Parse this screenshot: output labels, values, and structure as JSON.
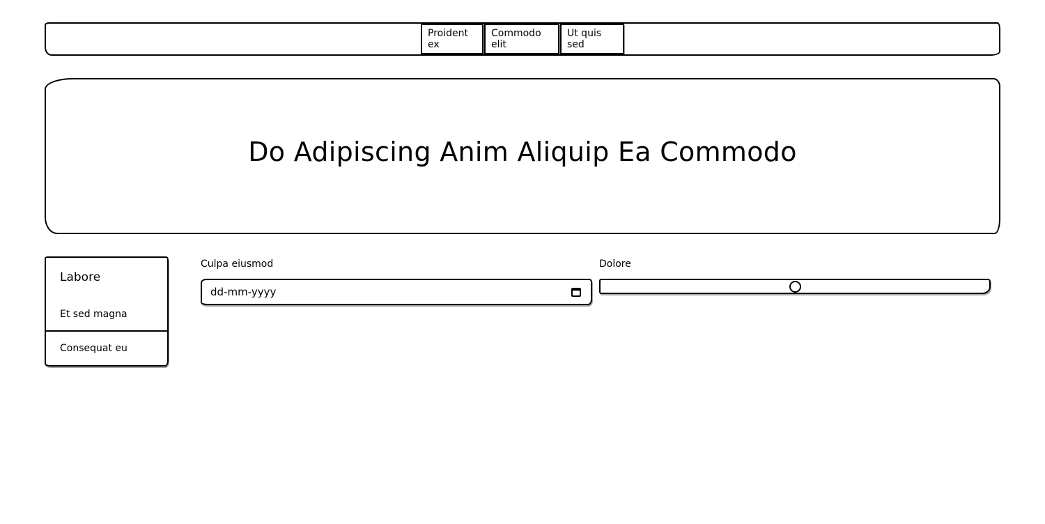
{
  "nav": {
    "items": [
      {
        "label": "Proident ex"
      },
      {
        "label": "Commodo elit"
      },
      {
        "label": "Ut quis sed"
      }
    ]
  },
  "hero": {
    "title": "Do Adipiscing Anim Aliquip Ea Commodo"
  },
  "sidebar": {
    "title": "Labore",
    "items": [
      {
        "label": "Et sed magna"
      },
      {
        "label": "Consequat eu"
      }
    ]
  },
  "form": {
    "date_field": {
      "label": "Culpa eiusmod",
      "placeholder": "dd-mm-yyyy"
    },
    "range_field": {
      "label": "Dolore",
      "value_fraction": 0.5
    }
  }
}
